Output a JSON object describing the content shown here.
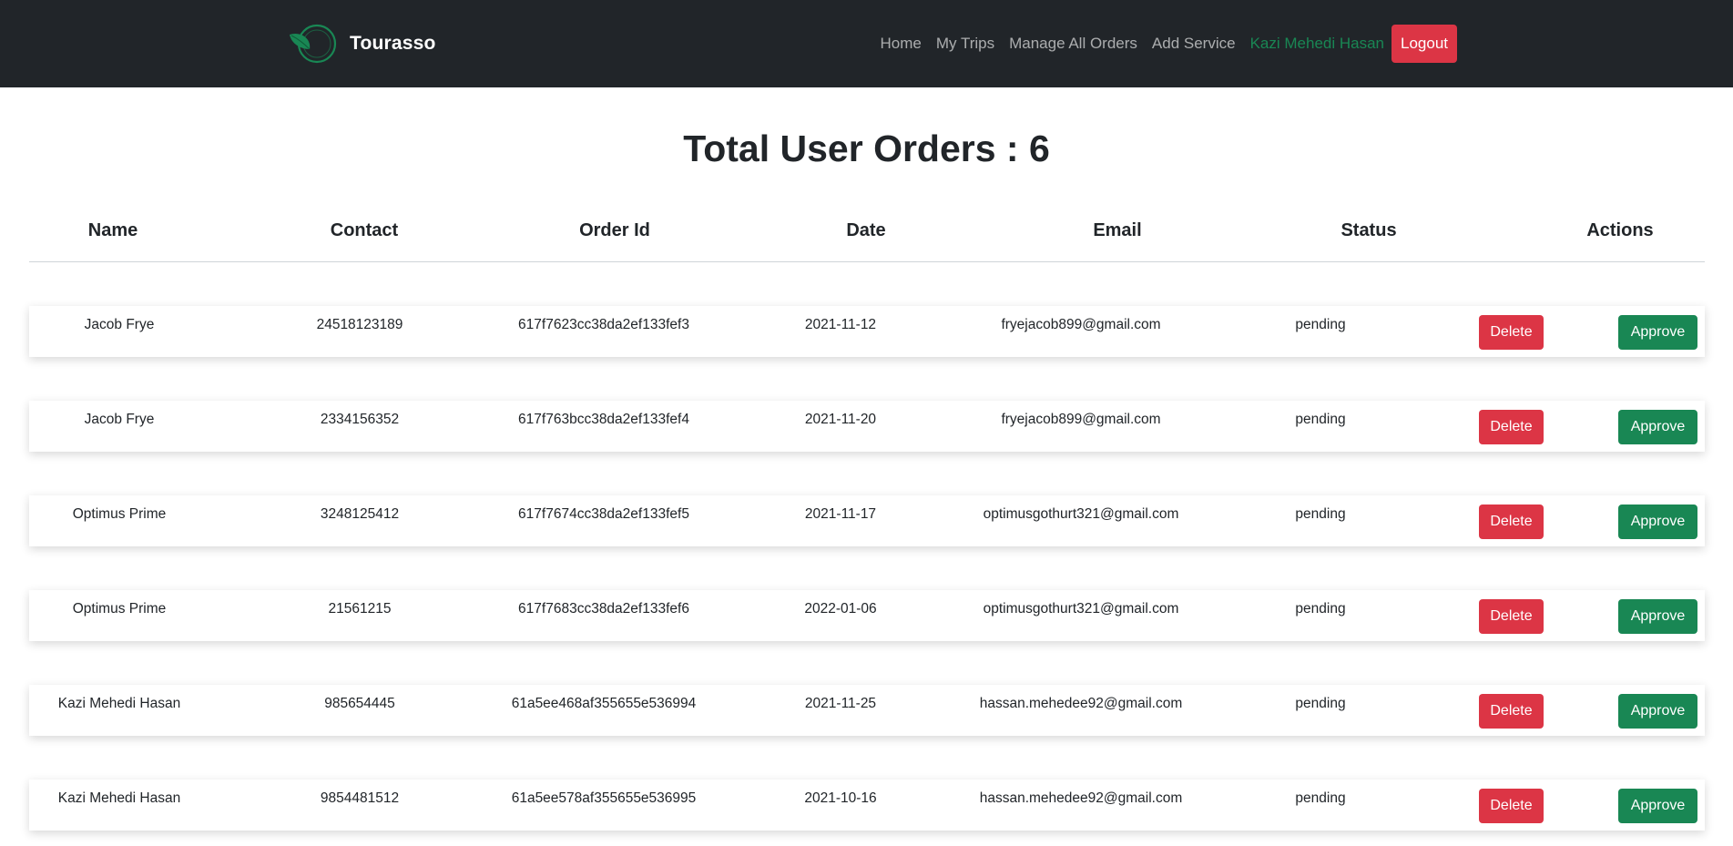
{
  "navbar": {
    "brand": "Tourasso",
    "links": [
      {
        "label": "Home"
      },
      {
        "label": "My Trips"
      },
      {
        "label": "Manage All Orders"
      },
      {
        "label": "Add Service"
      }
    ],
    "user_name": "Kazi Mehedi Hasan",
    "logout_label": "Logout",
    "logo_icon": "leaf-circle-logo-icon"
  },
  "page": {
    "title": "Total User Orders : 6"
  },
  "table": {
    "headers": [
      "Name",
      "Contact",
      "Order Id",
      "Date",
      "Email",
      "Status",
      "Actions"
    ],
    "rows": [
      {
        "name": "Jacob Frye",
        "contact": "24518123189",
        "order_id": "617f7623cc38da2ef133fef3",
        "date": "2021-11-12",
        "email": "fryejacob899@gmail.com",
        "status": "pending"
      },
      {
        "name": "Jacob Frye",
        "contact": "2334156352",
        "order_id": "617f763bcc38da2ef133fef4",
        "date": "2021-11-20",
        "email": "fryejacob899@gmail.com",
        "status": "pending"
      },
      {
        "name": "Optimus Prime",
        "contact": "3248125412",
        "order_id": "617f7674cc38da2ef133fef5",
        "date": "2021-11-17",
        "email": "optimusgothurt321@gmail.com",
        "status": "pending"
      },
      {
        "name": "Optimus Prime",
        "contact": "21561215",
        "order_id": "617f7683cc38da2ef133fef6",
        "date": "2022-01-06",
        "email": "optimusgothurt321@gmail.com",
        "status": "pending"
      },
      {
        "name": "Kazi Mehedi Hasan",
        "contact": "985654445",
        "order_id": "61a5ee468af355655e536994",
        "date": "2021-11-25",
        "email": "hassan.mehedee92@gmail.com",
        "status": "pending"
      },
      {
        "name": "Kazi Mehedi Hasan",
        "contact": "9854481512",
        "order_id": "61a5ee578af355655e536995",
        "date": "2021-10-16",
        "email": "hassan.mehedee92@gmail.com",
        "status": "pending"
      }
    ],
    "delete_label": "Delete",
    "approve_label": "Approve"
  },
  "colors": {
    "navbar_bg": "#212529",
    "danger": "#dc3545",
    "success": "#198754"
  }
}
